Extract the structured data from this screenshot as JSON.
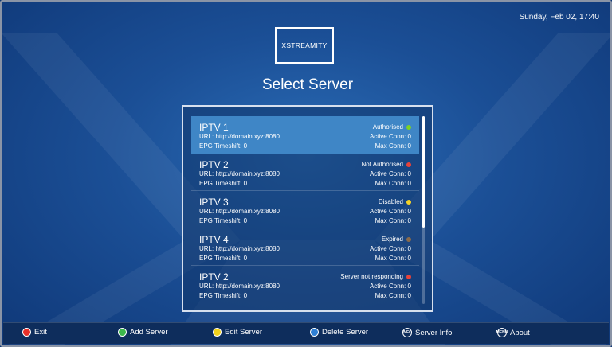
{
  "header": {
    "datetime": "Sunday, Feb 02, 17:40",
    "logo_text": "XSTREAMITY",
    "title": "Select Server"
  },
  "servers": [
    {
      "name": "IPTV 1",
      "url": "URL: http://domain.xyz:8080",
      "epg": "EPG Timeshift: 0",
      "status": "Authorised",
      "status_color": "#7ed321",
      "active": "Active Conn: 0",
      "max": "Max Conn: 0"
    },
    {
      "name": "IPTV 2",
      "url": "URL: http://domain.xyz:8080",
      "epg": "EPG Timeshift: 0",
      "status": "Not Authorised",
      "status_color": "#e8433a",
      "active": "Active Conn: 0",
      "max": "Max Conn: 0"
    },
    {
      "name": "IPTV 3",
      "url": "URL: http://domain.xyz:8080",
      "epg": "EPG Timeshift: 0",
      "status": "Disabled",
      "status_color": "#f5d327",
      "active": "Active Conn: 0",
      "max": "Max Conn: 0"
    },
    {
      "name": "IPTV 4",
      "url": "URL: http://domain.xyz:8080",
      "epg": "EPG Timeshift: 0",
      "status": "Expired",
      "status_color": "#8b6b4a",
      "active": "Active Conn: 0",
      "max": "Max Conn: 0"
    },
    {
      "name": "IPTV 2",
      "url": "URL: http://domain.xyz:8080",
      "epg": "EPG Timeshift: 0",
      "status": "Server not responding",
      "status_color": "#e8433a",
      "active": "Active Conn: 0",
      "max": "Max Conn: 0"
    }
  ],
  "footer": {
    "exit": "Exit",
    "add_server": "Add Server",
    "edit_server": "Edit Server",
    "delete_server": "Delete Server",
    "server_info": "Server Info",
    "about": "About",
    "colors": {
      "red": "#e8312a",
      "green": "#3cb64a",
      "yellow": "#f2d21d",
      "blue": "#2e7fd6"
    },
    "info_icon_label": "INFO",
    "menu_icon_label": "MENU"
  }
}
